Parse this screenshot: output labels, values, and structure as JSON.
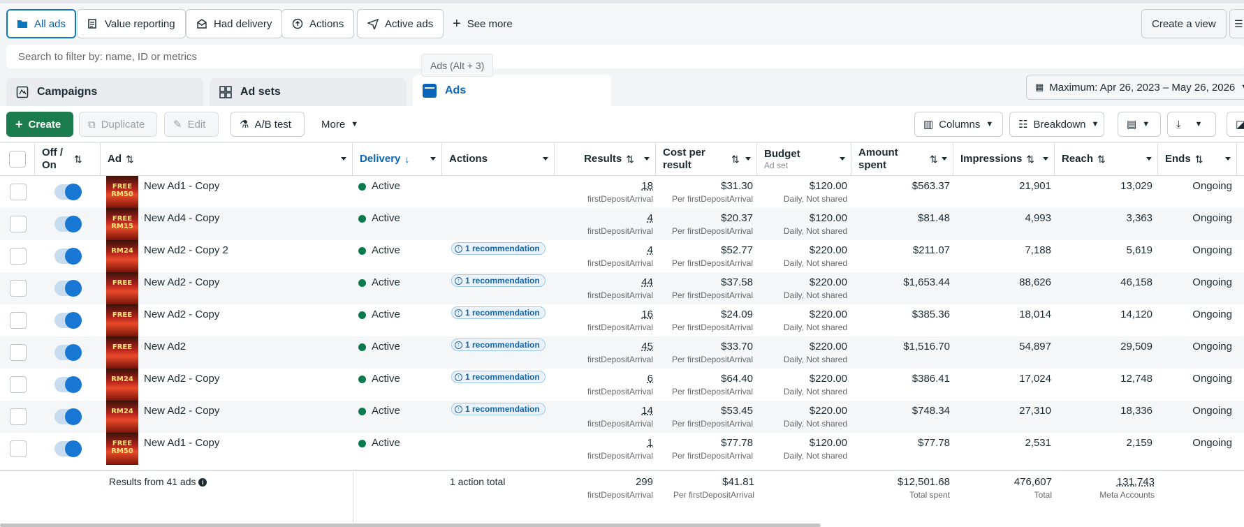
{
  "chips": [
    {
      "label": "All ads",
      "icon": "folder-icon"
    },
    {
      "label": "Value reporting",
      "icon": "report-icon"
    },
    {
      "label": "Had delivery",
      "icon": "envelope-icon"
    },
    {
      "label": "Actions",
      "icon": "upload-circle-icon"
    },
    {
      "label": "Active ads",
      "icon": "send-icon"
    }
  ],
  "see_more": "See more",
  "create_view": "Create a view",
  "search": {
    "placeholder": "Search to filter by: name, ID or metrics"
  },
  "tooltip": "Ads (Alt + 3)",
  "tabs": {
    "campaigns": "Campaigns",
    "adsets": "Ad sets",
    "ads": "Ads"
  },
  "date_range": "Maximum: Apr 26, 2023 – May 26, 2026",
  "toolbar": {
    "create": "Create",
    "duplicate": "Duplicate",
    "edit": "Edit",
    "abtest": "A/B test",
    "more": "More",
    "columns": "Columns",
    "breakdown": "Breakdown"
  },
  "columns": {
    "offon": "Off / On",
    "ad": "Ad",
    "delivery": "Delivery",
    "actions": "Actions",
    "results": "Results",
    "cpr": "Cost per result",
    "budget": "Budget",
    "budget_sub": "Ad set",
    "amount": "Amount spent",
    "impressions": "Impressions",
    "reach": "Reach",
    "ends": "Ends"
  },
  "rows": [
    {
      "name": "New Ad1 - Copy",
      "thumb": "FREE RM50",
      "delivery": "Active",
      "rec": "",
      "results": "18",
      "results_sub": "firstDepositArrival",
      "cpr": "$31.30",
      "cpr_sub": "Per firstDepositArrival",
      "budget": "$120.00",
      "budget_sub": "Daily, Not shared",
      "amount": "$563.37",
      "impressions": "21,901",
      "reach": "13,029",
      "ends": "Ongoing"
    },
    {
      "name": "New Ad4 - Copy",
      "thumb": "FREE RM15",
      "delivery": "Active",
      "rec": "",
      "results": "4",
      "results_sub": "firstDepositArrival",
      "cpr": "$20.37",
      "cpr_sub": "Per firstDepositArrival",
      "budget": "$120.00",
      "budget_sub": "Daily, Not shared",
      "amount": "$81.48",
      "impressions": "4,993",
      "reach": "3,363",
      "ends": "Ongoing"
    },
    {
      "name": "New Ad2 - Copy 2",
      "thumb": "RM24",
      "delivery": "Active",
      "rec": "1 recommendation",
      "results": "4",
      "results_sub": "firstDepositArrival",
      "cpr": "$52.77",
      "cpr_sub": "Per firstDepositArrival",
      "budget": "$220.00",
      "budget_sub": "Daily, Not shared",
      "amount": "$211.07",
      "impressions": "7,188",
      "reach": "5,619",
      "ends": "Ongoing"
    },
    {
      "name": "New Ad2 - Copy",
      "thumb": "FREE",
      "delivery": "Active",
      "rec": "1 recommendation",
      "results": "44",
      "results_sub": "firstDepositArrival",
      "cpr": "$37.58",
      "cpr_sub": "Per firstDepositArrival",
      "budget": "$220.00",
      "budget_sub": "Daily, Not shared",
      "amount": "$1,653.44",
      "impressions": "88,626",
      "reach": "46,158",
      "ends": "Ongoing"
    },
    {
      "name": "New Ad2 - Copy",
      "thumb": "FREE",
      "delivery": "Active",
      "rec": "1 recommendation",
      "results": "16",
      "results_sub": "firstDepositArrival",
      "cpr": "$24.09",
      "cpr_sub": "Per firstDepositArrival",
      "budget": "$220.00",
      "budget_sub": "Daily, Not shared",
      "amount": "$385.36",
      "impressions": "18,014",
      "reach": "14,120",
      "ends": "Ongoing"
    },
    {
      "name": "New Ad2",
      "thumb": "FREE",
      "delivery": "Active",
      "rec": "1 recommendation",
      "results": "45",
      "results_sub": "firstDepositArrival",
      "cpr": "$33.70",
      "cpr_sub": "Per firstDepositArrival",
      "budget": "$220.00",
      "budget_sub": "Daily, Not shared",
      "amount": "$1,516.70",
      "impressions": "54,897",
      "reach": "29,509",
      "ends": "Ongoing"
    },
    {
      "name": "New Ad2 - Copy",
      "thumb": "RM24",
      "delivery": "Active",
      "rec": "1 recommendation",
      "results": "6",
      "results_sub": "firstDepositArrival",
      "cpr": "$64.40",
      "cpr_sub": "Per firstDepositArrival",
      "budget": "$220.00",
      "budget_sub": "Daily, Not shared",
      "amount": "$386.41",
      "impressions": "17,024",
      "reach": "12,748",
      "ends": "Ongoing"
    },
    {
      "name": "New Ad2 - Copy",
      "thumb": "RM24",
      "delivery": "Active",
      "rec": "1 recommendation",
      "results": "14",
      "results_sub": "firstDepositArrival",
      "cpr": "$53.45",
      "cpr_sub": "Per firstDepositArrival",
      "budget": "$220.00",
      "budget_sub": "Daily, Not shared",
      "amount": "$748.34",
      "impressions": "27,310",
      "reach": "18,336",
      "ends": "Ongoing"
    },
    {
      "name": "New Ad1 - Copy",
      "thumb": "FREE RM50",
      "delivery": "Active",
      "rec": "",
      "results": "1",
      "results_sub": "firstDepositArrival",
      "cpr": "$77.78",
      "cpr_sub": "Per firstDepositArrival",
      "budget": "$120.00",
      "budget_sub": "Daily, Not shared",
      "amount": "$77.78",
      "impressions": "2,531",
      "reach": "2,159",
      "ends": "Ongoing"
    }
  ],
  "footer": {
    "label": "Results from 41 ads",
    "actions": "1 action total",
    "results": "299",
    "results_sub": "firstDepositArrival",
    "cpr": "$41.81",
    "cpr_sub": "Per firstDepositArrival",
    "amount": "$12,501.68",
    "amount_sub": "Total spent",
    "impressions": "476,607",
    "impressions_sub": "Total",
    "reach": "131,743",
    "reach_sub": "Meta Accounts"
  },
  "colors": {
    "accent": "#0a78be",
    "create": "#1b7c4d",
    "active_dot": "#0a7a4e",
    "toggle": "#1877d2"
  }
}
